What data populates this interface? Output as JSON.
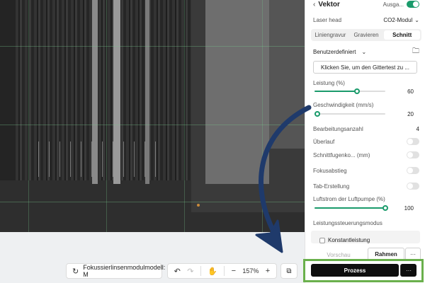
{
  "panel": {
    "back_icon": "chevron-left-icon",
    "title": "Vektor",
    "output_label": "Ausga...",
    "output_toggle": true,
    "laser_head_label": "Laser head",
    "laser_head_value": "CO2-Modul",
    "tabs": [
      "Liniengravur",
      "Gravieren",
      "Schnitt"
    ],
    "active_tab": "Schnitt",
    "preset": "Benutzerdefiniert",
    "grid_test_button": "Klicken Sie, um den Gittertest zu ...",
    "power": {
      "label": "Leistung (%)",
      "value": "60",
      "fraction": 0.6
    },
    "speed": {
      "label": "Geschwindigkeit (mm/s)",
      "value": "20",
      "fraction": 0.06
    },
    "passes": {
      "label": "Bearbeitungsanzahl",
      "value": "4"
    },
    "overlap": {
      "label": "Überlauf",
      "on": false
    },
    "kerf": {
      "label": "Schnittfugenko... (mm)",
      "on": false
    },
    "focus_step": {
      "label": "Fokusabstieg",
      "on": false
    },
    "tab_creation": {
      "label": "Tab-Erstellung",
      "on": false
    },
    "air_pump": {
      "label": "Luftstrom der Luftpumpe (%)",
      "value": "100",
      "fraction": 1.0
    },
    "power_control_label": "Leistungssteuerungsmodus",
    "constant_power_label": "Konstantleistung",
    "preview_button": "Vorschau",
    "frame_button": "Rahmen",
    "more_label": "···",
    "process_button": "Prozess",
    "process_more_label": "···"
  },
  "toolbar": {
    "lens_label": "Fokussierlinsenmodulmodell: M",
    "zoom": "157%"
  },
  "colors": {
    "accent": "#1a9b6b",
    "highlight_border": "#6ab04c",
    "arrow": "#1f3a6b",
    "process_button": "#0e0e0e"
  }
}
